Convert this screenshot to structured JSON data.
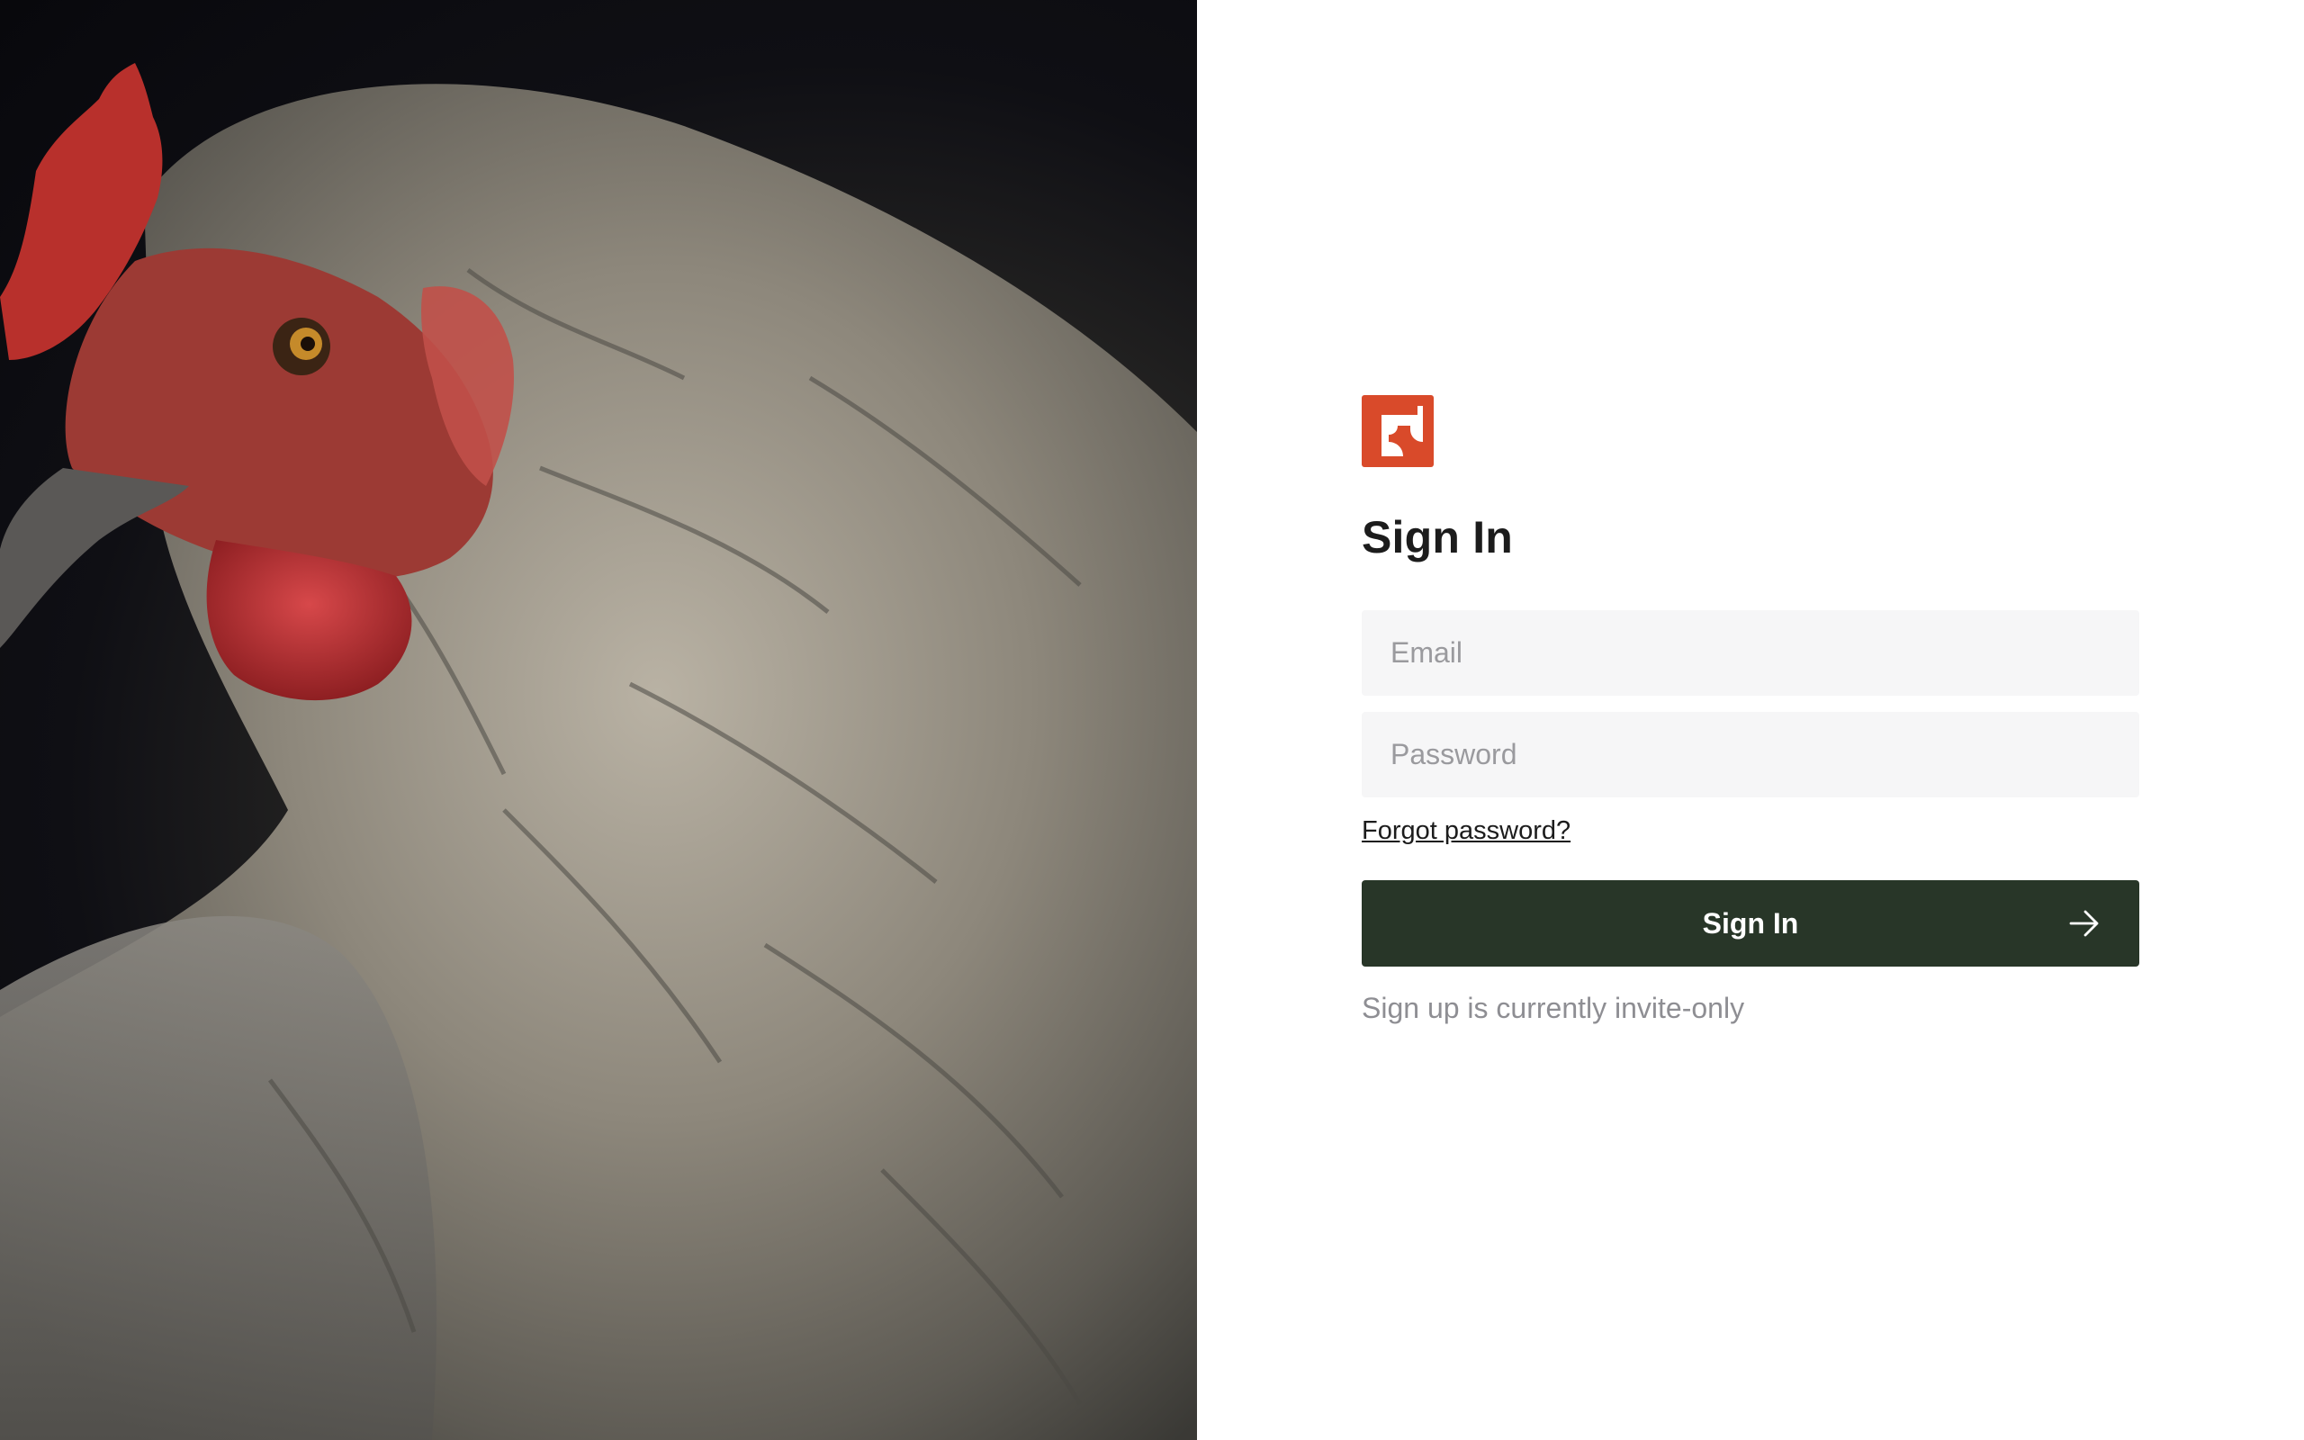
{
  "hero": {
    "image": "rooster-portrait-photo"
  },
  "brand": {
    "logo_icon": "brand-logo-icon",
    "logo_color": "#d94a2a"
  },
  "signin": {
    "title": "Sign In",
    "email_placeholder": "Email",
    "email_value": "",
    "password_placeholder": "Password",
    "password_value": "",
    "forgot_label": "Forgot password?",
    "submit_label": "Sign In",
    "submit_icon": "arrow-right-icon",
    "invite_note": "Sign up is currently invite-only"
  },
  "colors": {
    "button_bg": "#283628",
    "field_bg": "#f6f6f7",
    "muted_text": "#8e8e93"
  }
}
